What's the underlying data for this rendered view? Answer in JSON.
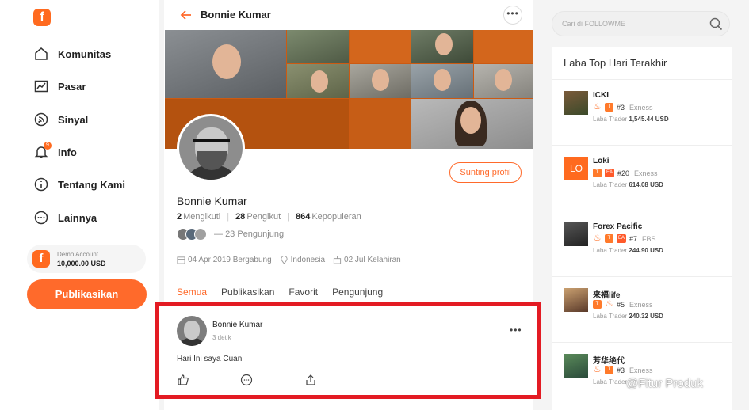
{
  "sidebar": {
    "logo": "f",
    "items": [
      {
        "label": "Komunitas",
        "icon": "home-icon"
      },
      {
        "label": "Pasar",
        "icon": "chart-icon"
      },
      {
        "label": "Sinyal",
        "icon": "rss-icon"
      },
      {
        "label": "Info",
        "icon": "bell-icon",
        "badge": "9"
      },
      {
        "label": "Tentang Kami",
        "icon": "info-icon"
      },
      {
        "label": "Lainnya",
        "icon": "more-icon"
      }
    ],
    "demo": {
      "title": "Demo Account",
      "value": "10,000.00 USD"
    },
    "publish_label": "Publikasikan"
  },
  "profile": {
    "header_title": "Bonnie Kumar",
    "edit_label": "Sunting profil",
    "name": "Bonnie Kumar",
    "stats": [
      {
        "value": "2",
        "label": "Mengikuti"
      },
      {
        "value": "28",
        "label": "Pengikut"
      },
      {
        "value": "864",
        "label": "Kepopuleran"
      }
    ],
    "visitors_text": "23 Pengunjung",
    "joined": "04 Apr 2019 Bergabung",
    "location": "Indonesia",
    "birthday": "02 Jul Kelahiran",
    "tabs": [
      "Semua",
      "Publikasikan",
      "Favorit",
      "Pengunjung"
    ],
    "active_tab": 0
  },
  "post": {
    "author": "Bonnie Kumar",
    "time": "3 detik",
    "text": "Hari Ini saya Cuan"
  },
  "search": {
    "placeholder": "Cari di FOLLOWME"
  },
  "top_profit": {
    "title": "Laba Top Hari Terakhir",
    "traders": [
      {
        "name": "ICKI",
        "rank": "#3",
        "broker": "Exness",
        "profit_label": "Laba Trader",
        "profit": "1,545.44 USD",
        "chips": [
          "flame",
          "t"
        ]
      },
      {
        "name": "Loki",
        "rank": "#20",
        "broker": "Exness",
        "profit_label": "Laba Trader",
        "profit": "614.08 USD",
        "chips": [
          "t",
          "ea"
        ],
        "avatar_text": "LO"
      },
      {
        "name": "Forex Pacific",
        "rank": "#7",
        "broker": "FBS",
        "profit_label": "Laba Trader",
        "profit": "244.90 USD",
        "chips": [
          "flame",
          "t",
          "ea"
        ]
      },
      {
        "name": "来福life",
        "rank": "#5",
        "broker": "Exness",
        "profit_label": "Laba Trader",
        "profit": "240.32 USD",
        "chips": [
          "t",
          "flame"
        ]
      },
      {
        "name": "芳华绝代",
        "rank": "#3",
        "broker": "Exness",
        "profit_label": "Laba Trader",
        "profit": "",
        "chips": [
          "flame",
          "t"
        ]
      }
    ]
  },
  "watermark": "@Fitur Produk",
  "colors": {
    "accent": "#ff6a2b",
    "highlight": "#e31b23"
  }
}
